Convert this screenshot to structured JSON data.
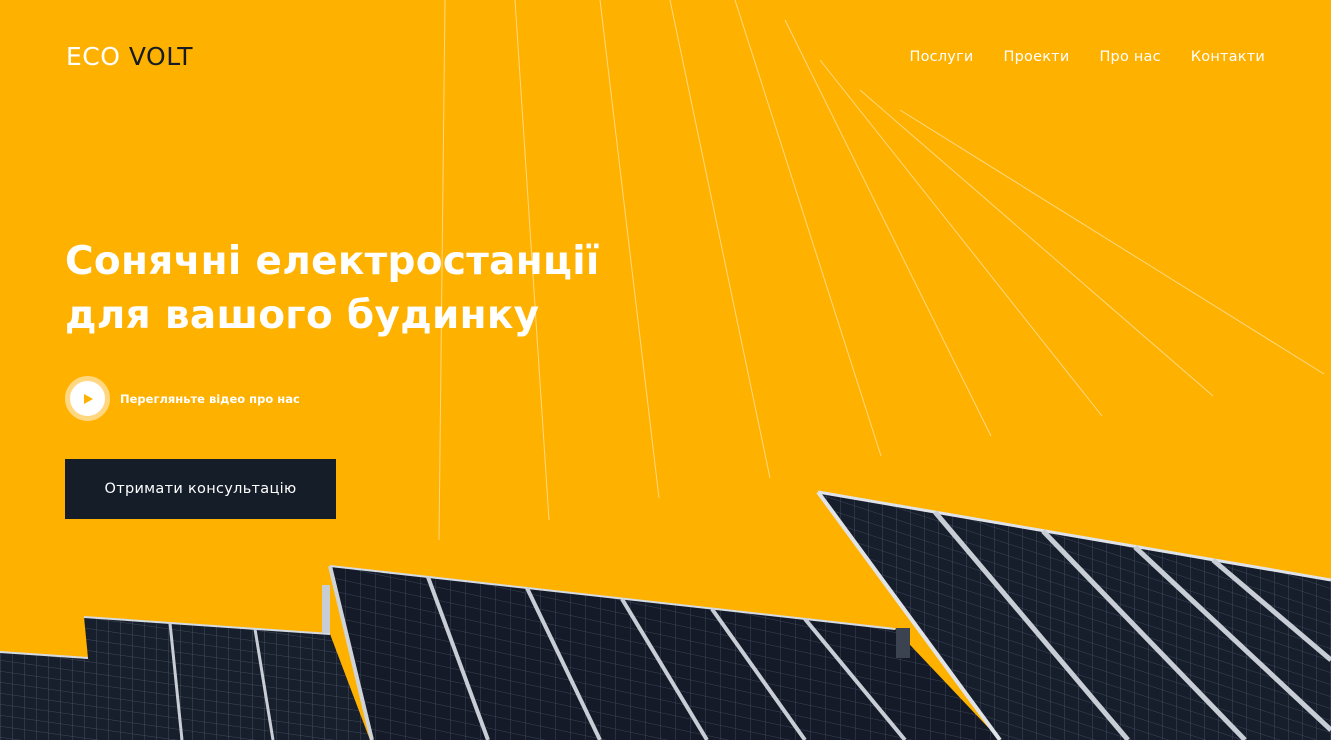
{
  "logo": {
    "part1": "ECO",
    "part2": "VOLT"
  },
  "nav": {
    "items": [
      {
        "label": "Послуги"
      },
      {
        "label": "Проекти"
      },
      {
        "label": "Про нас"
      },
      {
        "label": "Контакти"
      }
    ]
  },
  "hero": {
    "headline_line1": "Сонячні електростанції",
    "headline_line2": "для вашого будинку",
    "video_label": "Перегляньте відео про нас",
    "cta_label": "Отримати консультацію"
  },
  "colors": {
    "background": "#FFB100",
    "cta_background": "#141D28",
    "logo_dark": "#161C26",
    "panel_cell": "#161D2B",
    "panel_frame": "#D7DCE2"
  },
  "icons": {
    "play": "play-icon"
  }
}
